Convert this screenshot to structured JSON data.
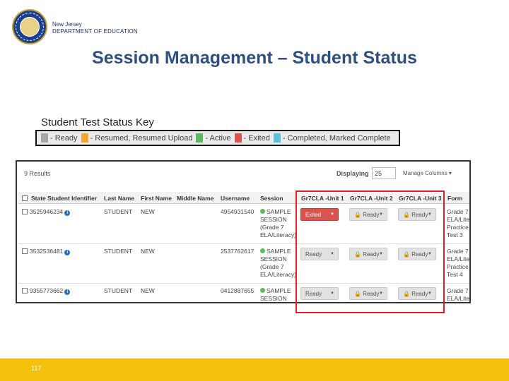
{
  "header": {
    "org_line1": "New Jersey",
    "org_line2": "DEPARTMENT OF EDUCATION"
  },
  "title": "Session Management – Student Status",
  "key": {
    "label": "Student Test Status Key",
    "items": [
      {
        "text": "- Ready",
        "color": "#a6a6a6"
      },
      {
        "text": "- Resumed, Resumed Upload",
        "color": "#f0a830"
      },
      {
        "text": "- Active",
        "color": "#5cb85c"
      },
      {
        "text": "- Exited",
        "color": "#d9534f"
      },
      {
        "text": "- Completed, Marked Complete",
        "color": "#5bc0de"
      }
    ]
  },
  "panel": {
    "results": "9 Results",
    "displaying": "Displaying",
    "page_size": "25",
    "manage_columns": "Manage Columns ▾",
    "columns": [
      "State Student Identifier",
      "Last Name",
      "First Name",
      "Middle Name",
      "Username",
      "Session",
      "Gr7CLA -Unit 1",
      "Gr7CLA -Unit 2",
      "Gr7CLA -Unit 3",
      "Form"
    ],
    "rows": [
      {
        "id": "3525946234",
        "last": "STUDENT",
        "first": "NEW",
        "user": "4954931540",
        "session": "SAMPLE SESSION (Grade 7 ELA/Literacy)",
        "u1": "Exited",
        "u2": "Ready",
        "u3": "Ready",
        "form": "Grade 7 ELA/Lite Practice Test 3"
      },
      {
        "id": "3532536481",
        "last": "STUDENT",
        "first": "NEW",
        "user": "2537762617",
        "session": "SAMPLE SESSION (Grade 7 ELA/Literacy)",
        "u1": "Ready",
        "u2": "Ready",
        "u3": "Ready",
        "form": "Grade 7 ELA/Lite Practice Test 4"
      },
      {
        "id": "9355773662",
        "last": "STUDENT",
        "first": "NEW",
        "user": "0412887655",
        "session": "SAMPLE SESSION",
        "u1": "Ready",
        "u2": "Ready",
        "u3": "Ready",
        "form": "Grade 7 ELA/Lite"
      }
    ]
  },
  "footer": {
    "page_number": "117"
  },
  "colors": {
    "title": "#2f4f7f",
    "footer": "#f6c10d",
    "highlight": "#e02020"
  }
}
